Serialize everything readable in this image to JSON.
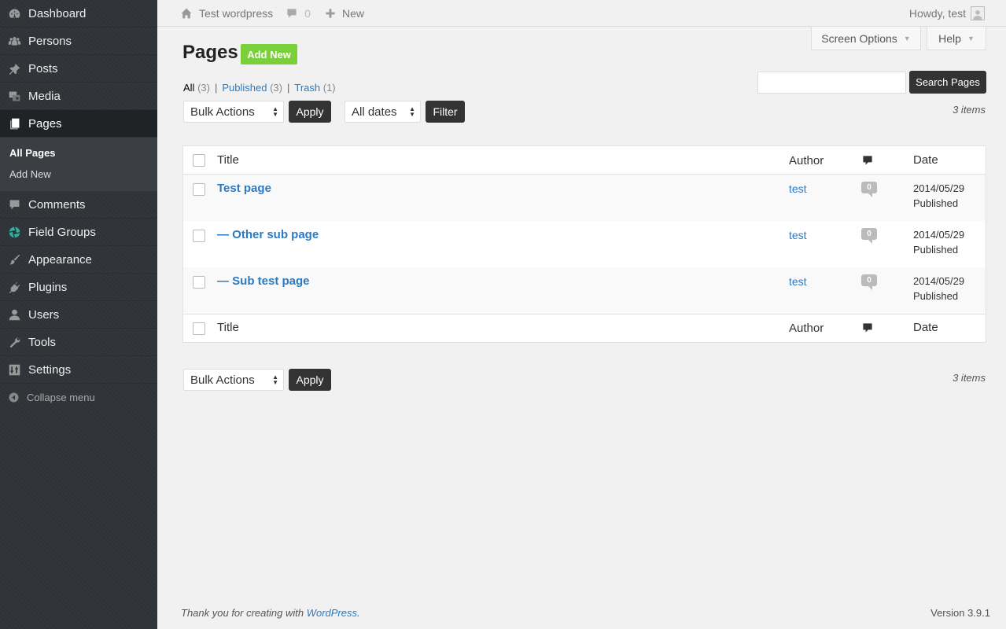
{
  "sidebar": {
    "items": [
      {
        "label": "Dashboard",
        "icon": "dashboard-icon"
      },
      {
        "label": "Persons",
        "icon": "persons-icon"
      },
      {
        "label": "Posts",
        "icon": "pin-icon"
      },
      {
        "label": "Media",
        "icon": "media-icon"
      },
      {
        "label": "Pages",
        "icon": "pages-icon"
      },
      {
        "label": "Comments",
        "icon": "comment-icon"
      },
      {
        "label": "Field Groups",
        "icon": "field-groups-icon"
      },
      {
        "label": "Appearance",
        "icon": "brush-icon"
      },
      {
        "label": "Plugins",
        "icon": "plugin-icon"
      },
      {
        "label": "Users",
        "icon": "user-icon"
      },
      {
        "label": "Tools",
        "icon": "wrench-icon"
      },
      {
        "label": "Settings",
        "icon": "settings-icon"
      }
    ],
    "submenu": [
      "All Pages",
      "Add New"
    ],
    "collapse_label": "Collapse menu"
  },
  "adminbar": {
    "site_name": "Test wordpress",
    "comment_count": "0",
    "new_label": "New",
    "howdy": "Howdy, test"
  },
  "screen_options_label": "Screen Options",
  "help_label": "Help",
  "page_title": "Pages",
  "add_new_label": "Add New",
  "filters": {
    "all_label": "All",
    "all_count": "(3)",
    "published_label": "Published",
    "published_count": "(3)",
    "trash_label": "Trash",
    "trash_count": "(1)",
    "sep": "|"
  },
  "search": {
    "button_label": "Search Pages",
    "value": ""
  },
  "bulk_actions": {
    "selected": "Bulk Actions",
    "apply_label": "Apply"
  },
  "dates": {
    "selected": "All dates",
    "filter_label": "Filter"
  },
  "items_count": "3 items",
  "table": {
    "columns": {
      "title": "Title",
      "author": "Author",
      "date": "Date"
    },
    "rows": [
      {
        "title": "Test page",
        "author": "test",
        "comments": "0",
        "date": "2014/05/29",
        "status": "Published"
      },
      {
        "title": "— Other sub page",
        "author": "test",
        "comments": "0",
        "date": "2014/05/29",
        "status": "Published"
      },
      {
        "title": "— Sub test page",
        "author": "test",
        "comments": "0",
        "date": "2014/05/29",
        "status": "Published"
      }
    ]
  },
  "footer": {
    "thanks_prefix": "Thank you for creating with ",
    "wp_link": "WordPress",
    "thanks_suffix": ".",
    "version": "Version 3.9.1"
  },
  "colors": {
    "accent": "#2a7ac4",
    "add_new": "#7ad03a",
    "sidebar": "#303438"
  }
}
